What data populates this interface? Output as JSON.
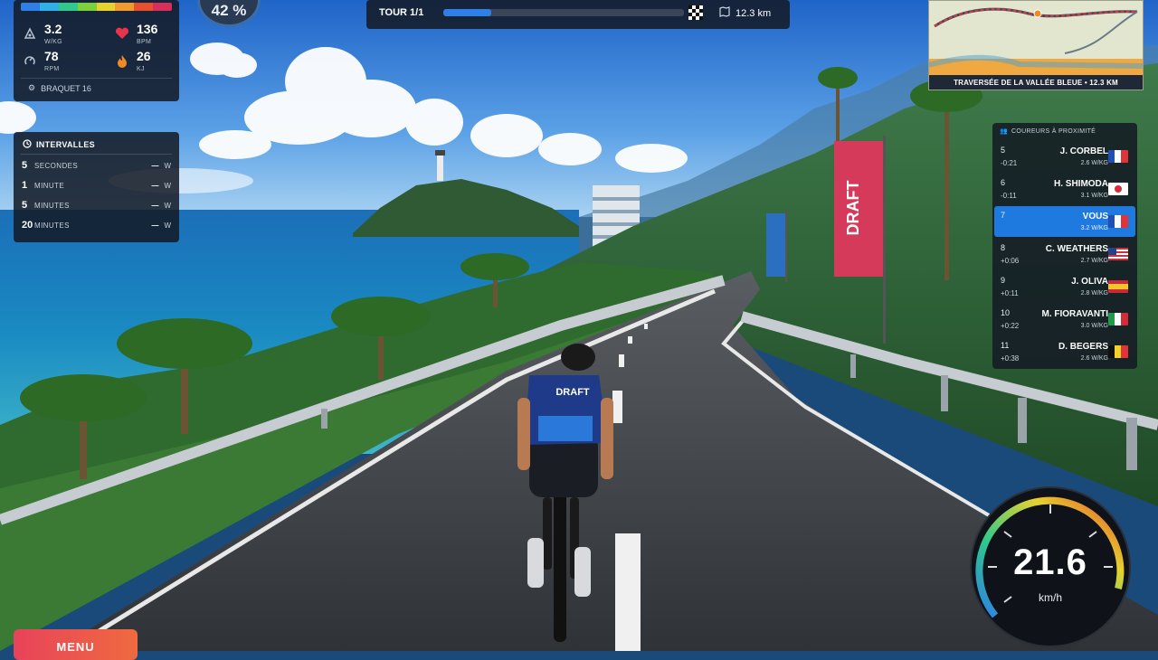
{
  "hud": {
    "gradient": "42 %",
    "stats": {
      "wkg_value": "3.2",
      "wkg_unit": "W/KG",
      "bpm_value": "136",
      "bpm_unit": "BPM",
      "rpm_value": "78",
      "rpm_unit": "RPM",
      "kj_value": "26",
      "kj_unit": "KJ",
      "gear": "BRAQUET 16"
    },
    "intervals": {
      "title": "INTERVALLES",
      "rows": [
        {
          "n": "5",
          "label": "SECONDES",
          "value": "—",
          "unit": "W"
        },
        {
          "n": "1",
          "label": "MINUTE",
          "value": "—",
          "unit": "W"
        },
        {
          "n": "5",
          "label": "MINUTES",
          "value": "—",
          "unit": "W"
        },
        {
          "n": "20",
          "label": "MINUTES",
          "value": "—",
          "unit": "W"
        }
      ]
    },
    "lap": {
      "label": "TOUR 1/1",
      "progress": 0.2,
      "distance": "12.3 km"
    },
    "minimap": {
      "caption": "TRAVERSÉE DE LA VALLÉE BLEUE • 12.3 KM"
    },
    "riders": {
      "title": "COUREURS À PROXIMITÉ",
      "list": [
        {
          "pos": "5",
          "gap": "-0:21",
          "name": "J. CORBEL",
          "wkg": "2.6 W/KG",
          "flag": "fr",
          "me": false
        },
        {
          "pos": "6",
          "gap": "-0:11",
          "name": "H. SHIMODA",
          "wkg": "3.1 W/KG",
          "flag": "jp",
          "me": false
        },
        {
          "pos": "7",
          "gap": "",
          "name": "VOUS",
          "wkg": "3.2 W/KG",
          "flag": "fr",
          "me": true
        },
        {
          "pos": "8",
          "gap": "+0:06",
          "name": "C. WEATHERS",
          "wkg": "2.7 W/KG",
          "flag": "us",
          "me": false
        },
        {
          "pos": "9",
          "gap": "+0:11",
          "name": "J. OLIVA",
          "wkg": "2.8 W/KG",
          "flag": "es",
          "me": false
        },
        {
          "pos": "10",
          "gap": "+0:22",
          "name": "M. FIORAVANTI",
          "wkg": "3.0 W/KG",
          "flag": "it",
          "me": false
        },
        {
          "pos": "11",
          "gap": "+0:38",
          "name": "D. BEGERS",
          "wkg": "2.6 W/KG",
          "flag": "be",
          "me": false
        }
      ]
    },
    "speed": {
      "value": "21.6",
      "unit": "km/h"
    },
    "menu_label": "MENU"
  },
  "scene": {
    "banner_text": "DRAFT",
    "jersey_text": "DRAFT"
  },
  "colors": {
    "accent": "#1f7ae0",
    "panel": "#141a24",
    "heart": "#e8344a",
    "flame": "#f08a24"
  }
}
